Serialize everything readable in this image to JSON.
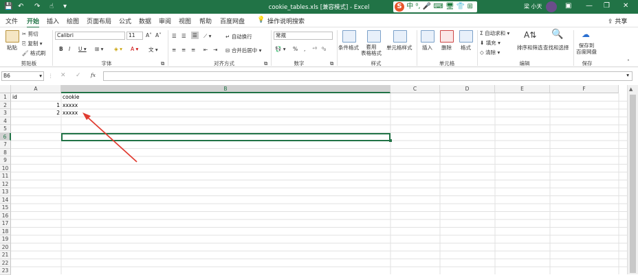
{
  "window": {
    "title": "cookie_tables.xls [兼容模式] - Excel",
    "user": "梁 小天",
    "share": "共享"
  },
  "ime": {
    "logo": "S",
    "label": "中 ⁰, 🎤 ⌨ 🖥 👕 ⊞"
  },
  "menu": [
    "文件",
    "开始",
    "插入",
    "绘图",
    "页面布局",
    "公式",
    "数据",
    "审阅",
    "视图",
    "帮助",
    "百度网盘",
    "操作说明搜索"
  ],
  "ribbon": {
    "paste": "粘贴",
    "cut": "剪切",
    "copy": "复制 ▾",
    "format_painter": "格式刷",
    "clipboard": "剪贴板",
    "font_name": "Calibri",
    "font_size": "11",
    "font_group": "字体",
    "wrap": "自动换行",
    "merge": "合并后居中 ▾",
    "align_group": "对齐方式",
    "number_format": "常规",
    "number_group": "数字",
    "conditional": "条件格式",
    "table_fmt": "套用\n表格格式",
    "cell_style": "单元格样式",
    "style_group": "样式",
    "insert": "插入",
    "delete": "删除",
    "format": "格式",
    "cells_group": "单元格",
    "autosum": "自动求和 ▾",
    "fill": "填充 ▾",
    "clear": "清除 ▾",
    "sort": "排序和筛选",
    "find": "查找和选择",
    "edit_group": "编辑",
    "save_baidu": "保存到\n百度网盘",
    "save_group": "保存"
  },
  "formula_bar": {
    "name_box": "B6",
    "fx": "fx",
    "value": ""
  },
  "columns": [
    "A",
    "B",
    "C",
    "D",
    "E",
    "F"
  ],
  "rows": [
    "1",
    "2",
    "3",
    "4",
    "5",
    "6",
    "7",
    "8",
    "9",
    "10",
    "11",
    "12",
    "13",
    "14",
    "15",
    "16",
    "17",
    "18",
    "19",
    "20",
    "21",
    "22",
    "23"
  ],
  "cells": {
    "A1": "id",
    "B1": "cookie",
    "A2": "1",
    "B2": "xxxxx",
    "A3": "2",
    "B3": "xxxxx"
  },
  "selected_cell": "B6",
  "colors": {
    "excel_green": "#217346",
    "arrow_red": "#e03c31"
  }
}
